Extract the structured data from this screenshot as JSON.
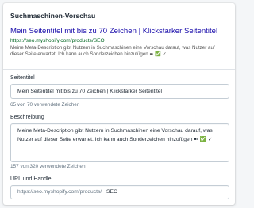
{
  "section": {
    "title": "Suchmaschinen-Vorschau"
  },
  "preview": {
    "title": "Mein Seitentitel mit bis zu 70 Zeichen | Klickstarker Seitentitel",
    "url": "https://seo.myshopify.com/products/SEO",
    "description_line1": "Meine Meta-Description gibt Nutzern in Suchmaschinen eine Vorschau darauf, was Nutzer auf",
    "description_line2": "dieser Seite erwartet. Ich kann auch Sonderzeichen hinzufügen ➼ ✅ ✓"
  },
  "fields": {
    "title": {
      "label": "Seitentitel",
      "value": "Mein Seitentitel mit bis zu 70 Zeichen | Klickstarker Seitentitel",
      "counter": "65 von 70 verwendete Zeichen"
    },
    "description": {
      "label": "Beschreibung",
      "value_line1": "Meine Meta-Description gibt Nutzern in Suchmaschinen eine Vorschau darauf, was",
      "value_line2": "Nutzer auf dieser Seite erwartet. Ich kann auch Sonderzeichen hinzufügen ➼ ✅ ✓",
      "counter": "157 von 320 verwendete Zeichen"
    },
    "url": {
      "label": "URL und Handle",
      "prefix": "https://seo.myshopify.com/products/",
      "handle": "SEO"
    }
  },
  "colors": {
    "link": "#1a0dab",
    "url": "#006621",
    "muted": "#637381",
    "border": "#c4cdd5"
  }
}
